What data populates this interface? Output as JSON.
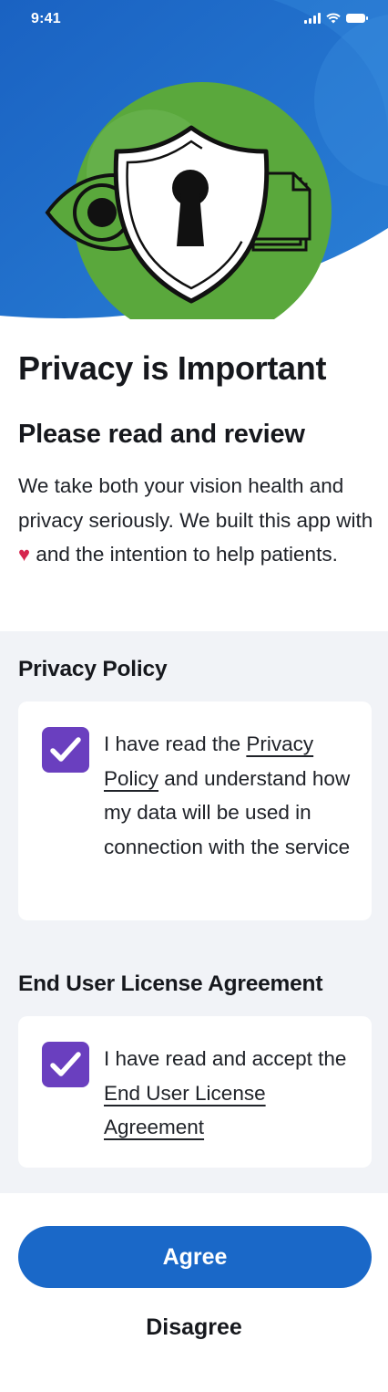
{
  "status_bar": {
    "time": "9:41"
  },
  "intro": {
    "title": "Privacy is Important",
    "subtitle": "Please read and review",
    "body_before_heart": "We take both your vision health and privacy seriously. We built this app with ",
    "heart": "♥",
    "body_after_heart": " and the intention to help patients."
  },
  "privacy_policy": {
    "heading": "Privacy Policy",
    "checked": true,
    "text_prefix": "I have read the ",
    "link_text": "Privacy Policy",
    "text_suffix": " and understand how my data will be used in connection with the service"
  },
  "eula": {
    "heading": "End User License Agreement",
    "checked": true,
    "text_prefix": "I have read and accept the ",
    "link_text": "End User License Agreement"
  },
  "actions": {
    "agree_label": "Agree",
    "disagree_label": "Disagree"
  },
  "colors": {
    "hero_blue": "#1a68c8",
    "hero_green": "#5aa83c",
    "checkbox_purple": "#6a3fbf",
    "button_blue": "#1a68c8",
    "heart_red": "#d6264f",
    "section_grey": "#f1f3f7"
  },
  "icons": [
    "signal-icon",
    "wifi-icon",
    "battery-icon",
    "shield-keyhole-icon",
    "eye-icon",
    "document-stack-icon",
    "checkmark-icon"
  ]
}
